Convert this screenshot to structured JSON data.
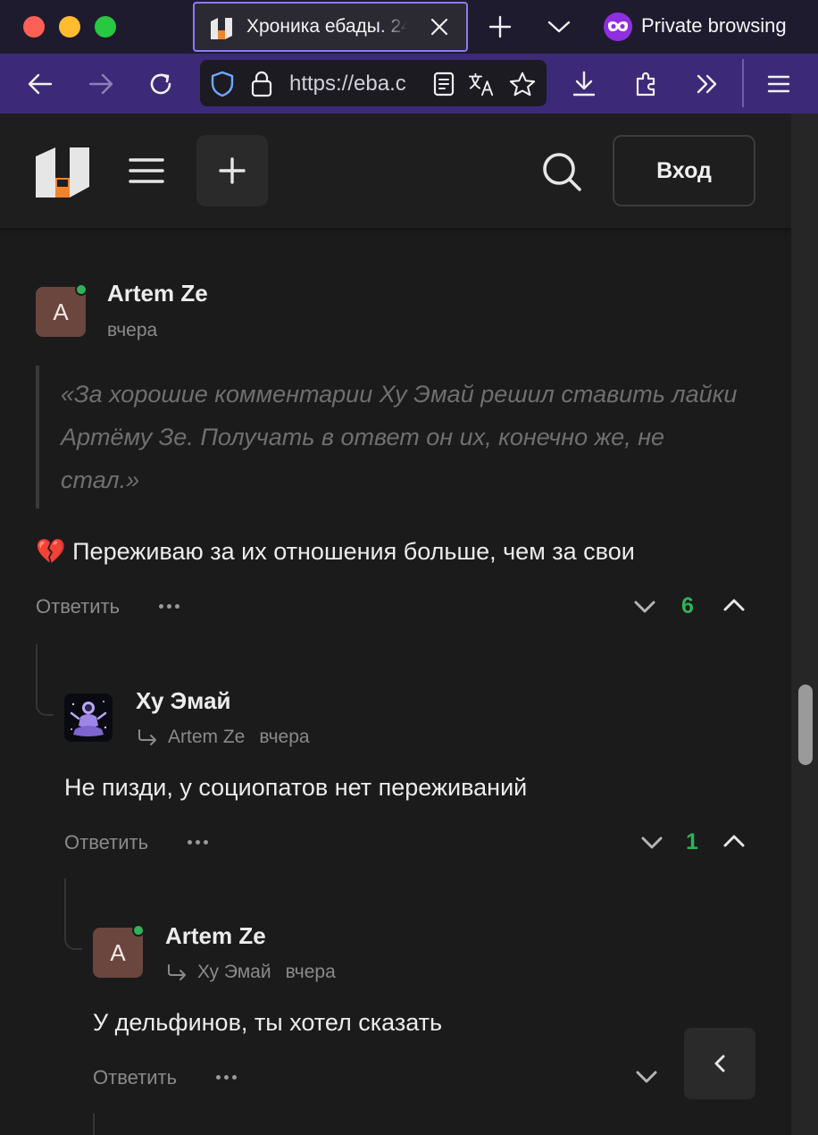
{
  "browser": {
    "tab": {
      "title": "Хроника ебады. 24"
    },
    "private_label": "Private browsing",
    "url": "https://eba.c"
  },
  "site": {
    "login_label": "Вход"
  },
  "comments": {
    "reply_label": "Ответить",
    "root": {
      "avatar_letter": "A",
      "author": "Artem Ze",
      "time": "вчера",
      "quote": "«За хорошие комментарии Ху Эмай решил ставить лайки Артёму Зе. Получать в ответ он их, конечно же, не стал.»",
      "emoji": "💔",
      "text": "Переживаю за их отношения больше, чем за свои",
      "score": "6"
    },
    "reply1": {
      "author": "Ху Эмай",
      "reply_to": "Artem Ze",
      "time": "вчера",
      "text": "Не пизди, у социопатов нет переживаний",
      "score": "1"
    },
    "reply2": {
      "avatar_letter": "A",
      "author": "Artem Ze",
      "reply_to": "Ху Эмай",
      "time": "вчера",
      "text": "У дельфинов, ты хотел сказать"
    }
  },
  "colors": {
    "accent_orange": "#f0842c",
    "score_green": "#2db35a",
    "private_purple": "#8f2fe0",
    "navbar_purple": "#3c2a78"
  },
  "icons": [
    "back-arrow-icon",
    "forward-arrow-icon",
    "reload-icon",
    "shield-icon",
    "lock-icon",
    "reader-view-icon",
    "translate-icon",
    "bookmark-star-icon",
    "download-icon",
    "extensions-icon",
    "overflow-chevrons-icon",
    "hamburger-menu-icon",
    "search-icon",
    "plus-icon",
    "chevron-down-icon",
    "chevron-up-icon",
    "reply-arrow-icon",
    "more-dots-icon",
    "chevron-left-icon"
  ]
}
